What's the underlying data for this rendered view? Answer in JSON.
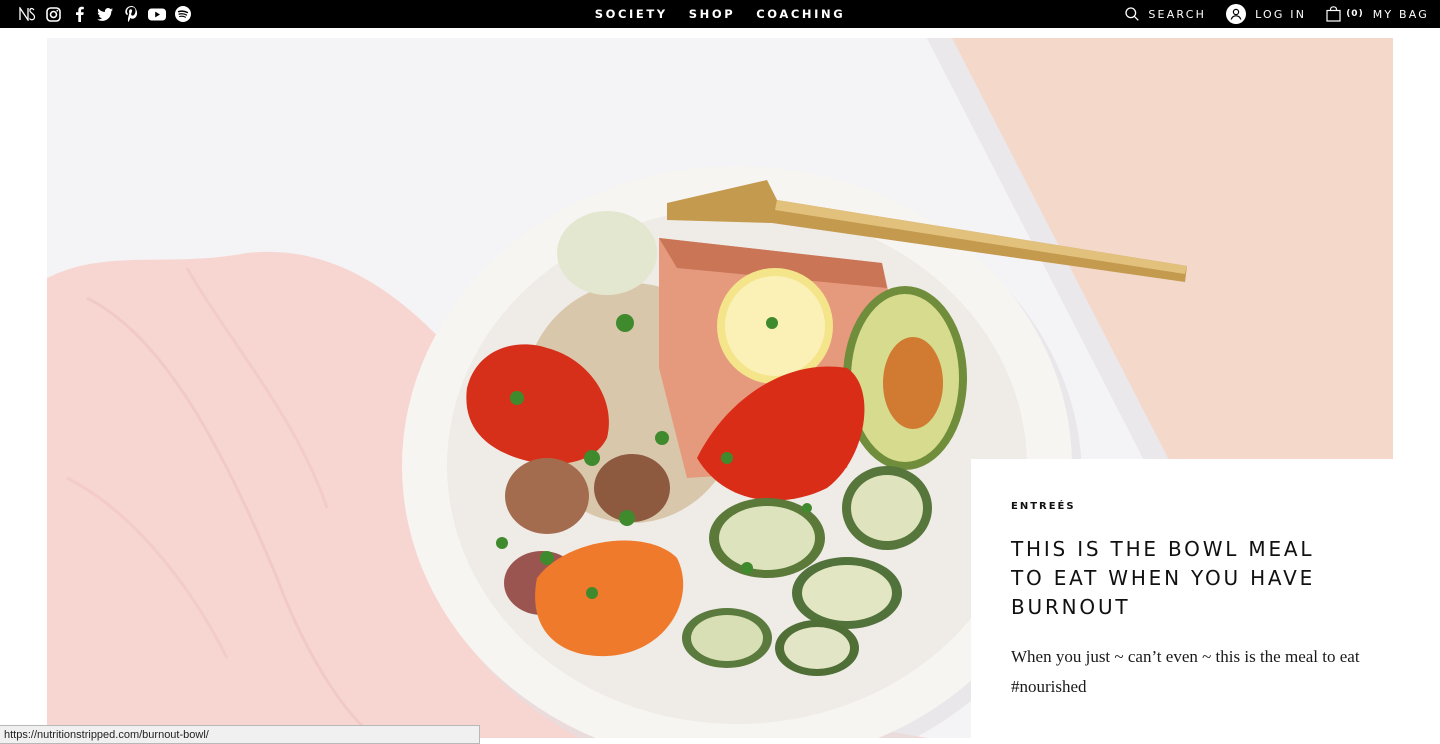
{
  "topbar": {
    "social": [
      {
        "name": "logo-ns-icon",
        "glyph": "N͓"
      },
      {
        "name": "instagram-icon"
      },
      {
        "name": "facebook-icon"
      },
      {
        "name": "twitter-icon"
      },
      {
        "name": "pinterest-icon"
      },
      {
        "name": "youtube-icon"
      },
      {
        "name": "spotify-icon"
      }
    ],
    "nav": [
      "SOCIETY",
      "SHOP",
      "COACHING"
    ],
    "search_label": "SEARCH",
    "login_label": "LOG IN",
    "bag_count": "(0)",
    "bag_label": "MY BAG"
  },
  "hero": {
    "category": "ENTREÉS",
    "title": "THIS IS THE BOWL MEAL TO EAT WHEN YOU HAVE BURNOUT",
    "excerpt": "When you just ~ can’t even ~ this is the meal to eat #nourished",
    "image_subject": "bowl-meal-photo"
  },
  "status_url": "https://nutritionstripped.com/burnout-bowl/",
  "colors": {
    "topbar_bg": "#000000",
    "card_bg": "#ffffff",
    "peach_bg": "#f5d9cc",
    "napkin_pink": "#f6d1cd"
  }
}
